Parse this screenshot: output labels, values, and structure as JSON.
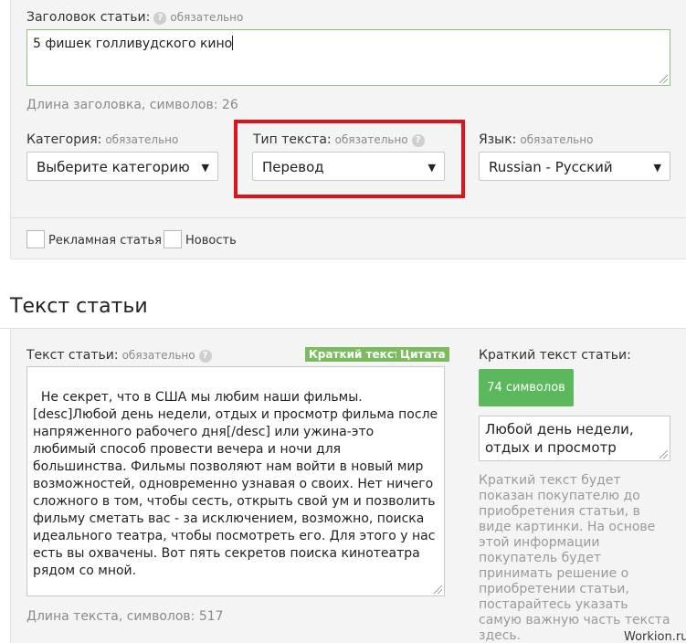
{
  "required_text": "обязательно",
  "help_symbol": "?",
  "title_field": {
    "label": "Заголовок статьи:",
    "value": "5 фишек голливудского кино",
    "length_label": "Длина заголовка, символов: 26"
  },
  "category": {
    "label": "Категория:",
    "selected": "Выберите категорию"
  },
  "text_type": {
    "label": "Тип текста:",
    "selected": "Перевод"
  },
  "language": {
    "label": "Язык:",
    "selected": "Russian - Русский"
  },
  "checkboxes": [
    {
      "label": "Рекламная статья",
      "checked": false
    },
    {
      "label": "Новость",
      "checked": false
    }
  ],
  "article_section": {
    "title": "Текст статьи",
    "text_label": "Текст статьи:",
    "tags": [
      "Краткий текст",
      "Цитата"
    ],
    "body": "Не секрет, что в США мы любим наши фильмы. [desc]Любой день недели, отдых и просмотр фильма после напряженного рабочего дня[/desc] или ужина-это любимый способ провести вечера и ночи для большинства. Фильмы позволяют нам войти в новый мир возможностей, одновременно узнавая о своих. Нет ничего сложного в том, чтобы сесть, открыть свой ум и позволить фильму сметать вас - за исключением, возможно, поиска идеального театра, чтобы посмотреть его. Для этого у нас есть вы охвачены. Вот пять секретов поиска кинотеатра рядом со мной.",
    "length_label": "Длина текста, символов: 517"
  },
  "short_text": {
    "label": "Краткий текст статьи:",
    "count_button": "74 символов",
    "value": "Любой день недели, отдых и просмотр",
    "hint": "Краткий текст будет показан покупателю до приобретения статьи, в виде картинки. На основе этой информации покупатель будет принимать решение о приобретении статьи, постарайтесь указать самую важную часть текста здесь."
  },
  "watermark": "Workion.ru",
  "colors": {
    "accent_green": "#5cb85c",
    "tag_green": "#7dbb5f",
    "highlight_red": "#e0121a"
  }
}
